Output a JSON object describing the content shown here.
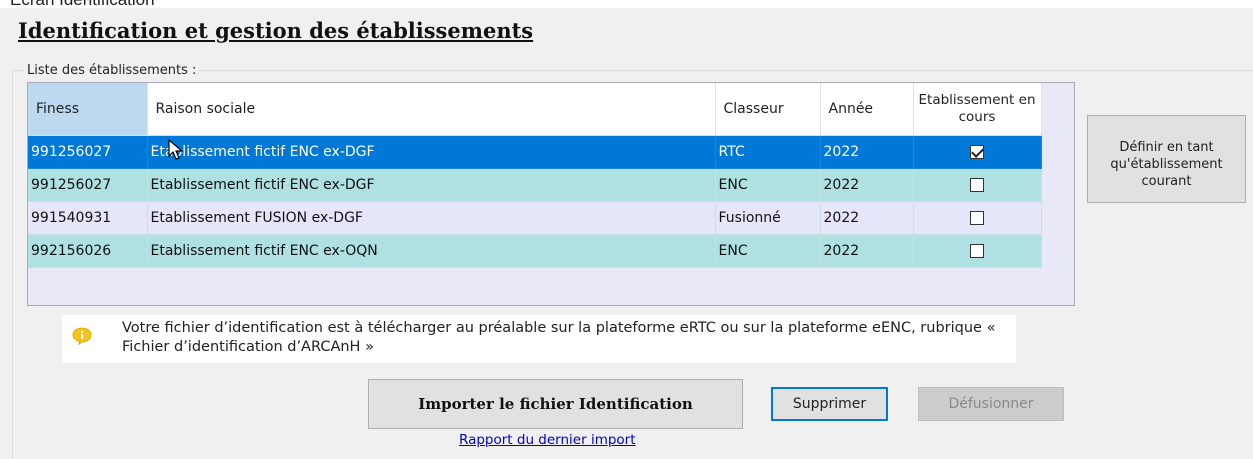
{
  "caption_fragment": "Ecran Identification",
  "page": {
    "title": "Identification et gestion des établissements",
    "group_label": "Liste des établissements :"
  },
  "table": {
    "columns": [
      "Finess",
      "Raison sociale",
      "Classeur",
      "Année",
      "Etablissement en cours"
    ],
    "rows": [
      {
        "finess": "991256027",
        "raison_sociale": "Etablissement fictif ENC ex-DGF",
        "classeur": "RTC",
        "annee": "2022",
        "en_cours": true
      },
      {
        "finess": "991256027",
        "raison_sociale": "Etablissement fictif ENC ex-DGF",
        "classeur": "ENC",
        "annee": "2022",
        "en_cours": false
      },
      {
        "finess": "991540931",
        "raison_sociale": "Etablissement FUSION ex-DGF",
        "classeur": "Fusionné",
        "annee": "2022",
        "en_cours": false
      },
      {
        "finess": "992156026",
        "raison_sociale": "Etablissement fictif ENC ex-OQN",
        "classeur": "ENC",
        "annee": "2022",
        "en_cours": false
      }
    ],
    "selected_row": 0
  },
  "side_button": {
    "label": "Définir en tant qu'établissement courant"
  },
  "info": {
    "icon": "info-bubble-icon",
    "text": "Votre fichier d’identification est à télécharger au préalable sur la plateforme eRTC ou sur la plateforme eENC, rubrique « Fichier d’identification d’ARCAnH »"
  },
  "buttons": {
    "import": "Importer le fichier Identification",
    "delete": "Supprimer",
    "unmerge": "Défusionner"
  },
  "link": {
    "last_import_report": "Rapport du dernier import"
  },
  "colors": {
    "selected_row": "#0078d7",
    "teal_row": "#afe0e2",
    "lavender_row": "#e6e6fa",
    "sorted_header": "#bcd9ef",
    "info_icon": "#f5c518",
    "link": "#0000cc"
  }
}
